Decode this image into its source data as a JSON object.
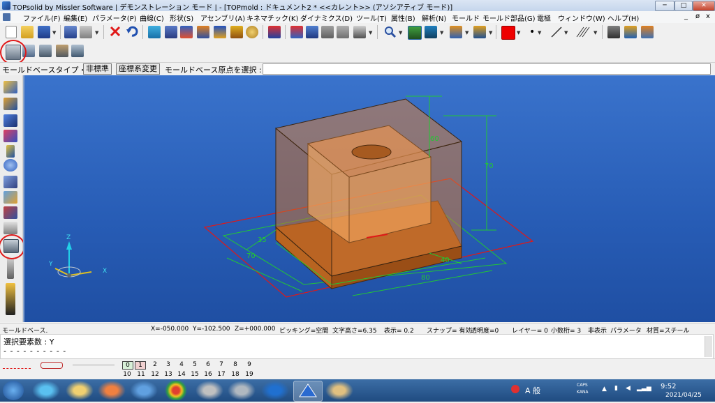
{
  "window": {
    "title": "TOPsolid by Missler Software | デモンストレーション モード | - [TOPmold : ドキュメント2 *  <<カレント>> (アソシアティブ モード)]",
    "min_glyph": "─",
    "max_glyph": "□",
    "close_glyph": "✕"
  },
  "menu": {
    "items": [
      "ファイル(F)",
      "編集(E)",
      "パラメータ(P)",
      "曲線(C)",
      "形状(S)",
      "アセンブリ(A)",
      "キネマチック(K)",
      "ダイナミクス(D)",
      "ツール(T)",
      "属性(B)",
      "解析(N)",
      "モールド",
      "モールド部品(G)",
      "電極",
      "ウィンドウ(W)",
      "ヘルプ(H)"
    ],
    "mdi": [
      "_",
      "ø",
      "x"
    ]
  },
  "prompt": {
    "label": "モールドベースタイプ =",
    "btn1": "非標準",
    "btn2": "座標系変更",
    "instruction": "モールドベース原点を選択 :",
    "input_value": ""
  },
  "viewport": {
    "dims": [
      "60",
      "70",
      "35",
      "70",
      "40",
      "80"
    ],
    "axes": {
      "z": "Z",
      "y": "Y",
      "x": "X"
    }
  },
  "status": {
    "mode": "モールドベース.",
    "x": "X=-050.000",
    "y": "Y=-102.500",
    "z": "Z=+000.000",
    "picking": "ピッキング=空間",
    "text_height": "文字高さ=6.35",
    "display": "表示=  0.2",
    "snap": "スナップ= 有効",
    "transparency": "透明度=0",
    "layer": "レイヤー=  0",
    "decimals": "小数桁= 3",
    "hide": "非表示",
    "param": "パラメータ",
    "material": "材質=スチール"
  },
  "selection": {
    "count_label": "選択要素数 : Y",
    "dashes": "- - - - - - - - - -"
  },
  "layers": {
    "row1": [
      "0",
      "1",
      "2",
      "3",
      "4",
      "5",
      "6",
      "7",
      "8",
      "9"
    ],
    "row2": [
      "10",
      "11",
      "12",
      "13",
      "14",
      "15",
      "16",
      "17",
      "18",
      "19"
    ]
  },
  "taskbar": {
    "ime": "A 般",
    "caps": "CAPS",
    "kana": "KANA",
    "time": "9:52",
    "date": "2021/04/25"
  },
  "colors": {
    "viewport_bg": "#2a60b8",
    "block": "#c8702a",
    "dim_green": "#22c833",
    "highlight_red": "#e01818"
  }
}
